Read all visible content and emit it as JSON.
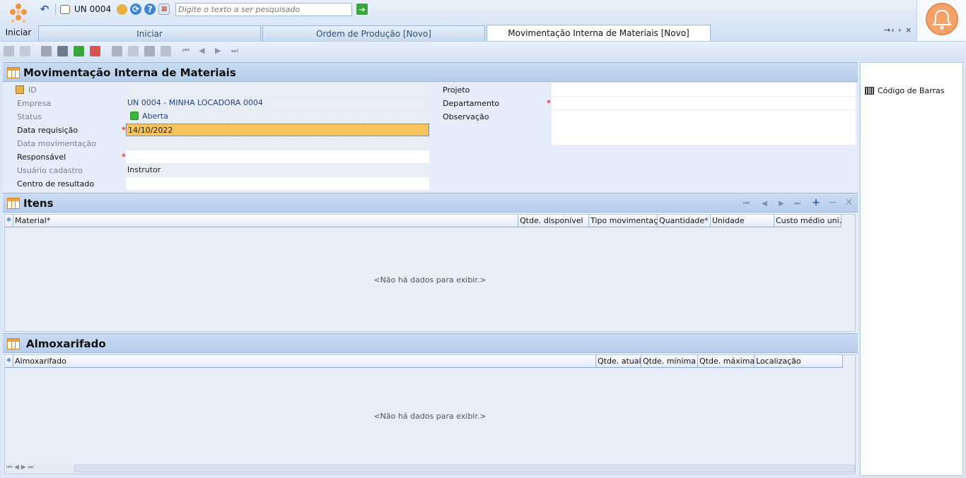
{
  "topbar": {
    "start_label": "Iniciar",
    "unit_label": "UN 0004",
    "search_placeholder": "Digite o texto a ser pesquisado",
    "tabs": [
      {
        "label": "Iniciar"
      },
      {
        "label": "Ordem de Produção [Novo]"
      },
      {
        "label": "Movimentação Interna de Materiais [Novo]"
      }
    ],
    "tab_nav": "→‹ › ×"
  },
  "header": {
    "title": "Movimentação Interna de Materiais"
  },
  "form": {
    "id_label": "ID",
    "id_value": "",
    "empresa_label": "Empresa",
    "empresa_value": "UN 0004 - MINHA LOCADORA 0004",
    "status_label": "Status",
    "status_value": "Aberta",
    "data_req_label": "Data requisição",
    "data_req_value": "14/10/2022",
    "data_mov_label": "Data movimentação",
    "responsavel_label": "Responsável",
    "usuario_label": "Usuário cadastro",
    "usuario_value": "Instrutor",
    "centro_label": "Centro de resultado",
    "projeto_label": "Projeto",
    "departamento_label": "Departamento",
    "observacao_label": "Observação",
    "required_mark": "*"
  },
  "itens": {
    "title": "Itens",
    "columns": [
      "Material*",
      "Qtde. disponível",
      "Tipo movimentação",
      "Quantidade*",
      "Unidade",
      "Custo médio uni."
    ],
    "empty": "<Não há dados para exibir.>"
  },
  "almox": {
    "title": "Almoxarifado",
    "columns": [
      "Almoxarifado",
      "Qtde. atual",
      "Qtde. mínima",
      "Qtde. máxima",
      "Localização"
    ],
    "empty": "<Não há dados para exibir.>"
  },
  "side": {
    "barcode_label": "Código de Barras"
  },
  "colors": {
    "accent_orange": "#f3a36a",
    "header_blue": "#cbdcf2",
    "focus_field": "#f7c35b",
    "status_green": "#3cb63c"
  }
}
